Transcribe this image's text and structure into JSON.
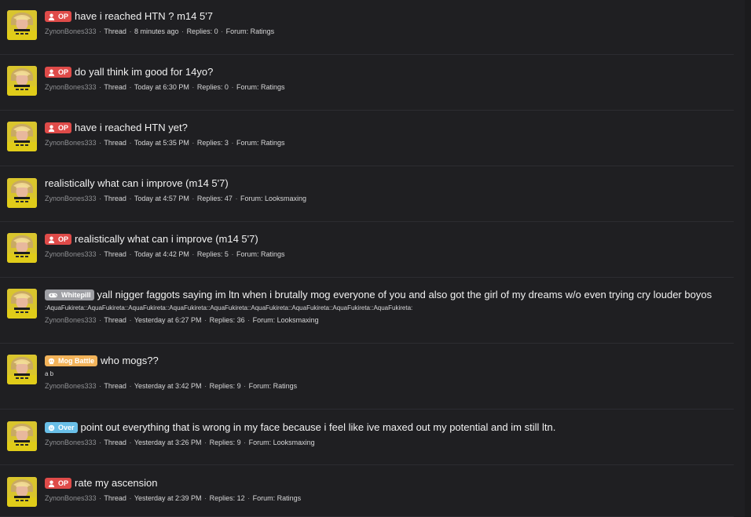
{
  "threads": [
    {
      "prefix": {
        "label": "OP",
        "type": "op",
        "icon": "person-icon"
      },
      "title": "have i reached HTN ? m14 5'7",
      "subline": "",
      "author": "ZynonBones333",
      "type": "Thread",
      "time": "8 minutes ago",
      "replies_text": "Replies: 0",
      "forum_text": "Forum: Ratings"
    },
    {
      "prefix": {
        "label": "OP",
        "type": "op",
        "icon": "person-icon"
      },
      "title": "do yall think im good for 14yo?",
      "subline": "",
      "author": "ZynonBones333",
      "type": "Thread",
      "time": "Today at 6:30 PM",
      "replies_text": "Replies: 0",
      "forum_text": "Forum: Ratings"
    },
    {
      "prefix": {
        "label": "OP",
        "type": "op",
        "icon": "person-icon"
      },
      "title": "have i reached HTN yet?",
      "subline": "",
      "author": "ZynonBones333",
      "type": "Thread",
      "time": "Today at 5:35 PM",
      "replies_text": "Replies: 3",
      "forum_text": "Forum: Ratings"
    },
    {
      "prefix": null,
      "title": "realistically what can i improve (m14 5'7)",
      "subline": "",
      "author": "ZynonBones333",
      "type": "Thread",
      "time": "Today at 4:57 PM",
      "replies_text": "Replies: 47",
      "forum_text": "Forum: Looksmaxing"
    },
    {
      "prefix": {
        "label": "OP",
        "type": "op",
        "icon": "person-icon"
      },
      "title": "realistically what can i improve (m14 5'7)",
      "subline": "",
      "author": "ZynonBones333",
      "type": "Thread",
      "time": "Today at 4:42 PM",
      "replies_text": "Replies: 5",
      "forum_text": "Forum: Ratings"
    },
    {
      "prefix": {
        "label": "Whitepill",
        "type": "whitepill",
        "icon": "gamepad-icon"
      },
      "title": "yall nigger faggots saying im ltn when i brutally mog everyone of you and also got the girl of my dreams w/o even trying cry louder boyos",
      "subline": ":AquaFukireta::AquaFukireta::AquaFukireta::AquaFukireta::AquaFukireta::AquaFukireta::AquaFukireta::AquaFukireta::AquaFukireta:",
      "author": "ZynonBones333",
      "type": "Thread",
      "time": "Yesterday at 6:27 PM",
      "replies_text": "Replies: 36",
      "forum_text": "Forum: Looksmaxing"
    },
    {
      "prefix": {
        "label": "Mog Battle",
        "type": "mog",
        "icon": "skull-icon"
      },
      "title": "who mogs??",
      "subline": "a b",
      "author": "ZynonBones333",
      "type": "Thread",
      "time": "Yesterday at 3:42 PM",
      "replies_text": "Replies: 9",
      "forum_text": "Forum: Ratings"
    },
    {
      "prefix": {
        "label": "Over",
        "type": "over",
        "icon": "face-icon"
      },
      "title": "point out everything that is wrong in my face because i feel like ive maxed out my potential and im still ltn.",
      "subline": "",
      "author": "ZynonBones333",
      "type": "Thread",
      "time": "Yesterday at 3:26 PM",
      "replies_text": "Replies: 9",
      "forum_text": "Forum: Looksmaxing"
    },
    {
      "prefix": {
        "label": "OP",
        "type": "op",
        "icon": "person-icon"
      },
      "title": "rate my ascension",
      "subline": "",
      "author": "ZynonBones333",
      "type": "Thread",
      "time": "Yesterday at 2:39 PM",
      "replies_text": "Replies: 12",
      "forum_text": "Forum: Ratings"
    }
  ],
  "meta_separator": "·"
}
